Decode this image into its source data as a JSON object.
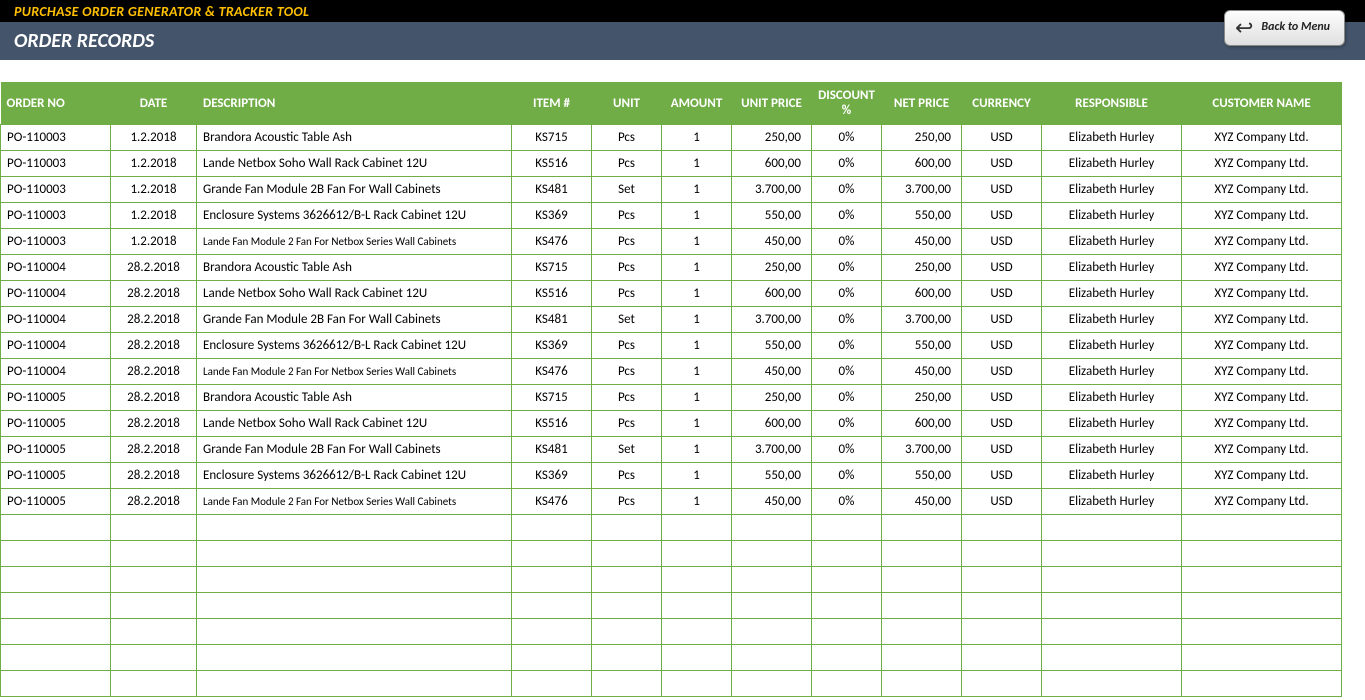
{
  "header": {
    "app_title": "PURCHASE ORDER GENERATOR & TRACKER TOOL",
    "page_title": "ORDER RECORDS",
    "back_button": "Back to Menu"
  },
  "columns": {
    "order_no": "ORDER NO",
    "date": "DATE",
    "description": "DESCRIPTION",
    "item": "ITEM #",
    "unit": "UNIT",
    "amount": "AMOUNT",
    "unit_price": "UNIT PRICE",
    "discount": "DISCOUNT %",
    "net_price": "NET PRICE",
    "currency": "CURRENCY",
    "responsible": "RESPONSIBLE",
    "customer": "CUSTOMER NAME"
  },
  "rows": [
    {
      "order_no": "PO-110003",
      "date": "1.2.2018",
      "description": "Brandora Acoustic Table Ash",
      "item": "KS715",
      "unit": "Pcs",
      "amount": "1",
      "unit_price": "250,00",
      "discount": "0%",
      "net_price": "250,00",
      "currency": "USD",
      "responsible": "Elizabeth Hurley",
      "customer": "XYZ Company Ltd.",
      "small": false
    },
    {
      "order_no": "PO-110003",
      "date": "1.2.2018",
      "description": "Lande Netbox Soho Wall Rack Cabinet 12U",
      "item": "KS516",
      "unit": "Pcs",
      "amount": "1",
      "unit_price": "600,00",
      "discount": "0%",
      "net_price": "600,00",
      "currency": "USD",
      "responsible": "Elizabeth Hurley",
      "customer": "XYZ Company Ltd.",
      "small": false
    },
    {
      "order_no": "PO-110003",
      "date": "1.2.2018",
      "description": "Grande Fan Module 2B Fan For Wall Cabinets",
      "item": "KS481",
      "unit": "Set",
      "amount": "1",
      "unit_price": "3.700,00",
      "discount": "0%",
      "net_price": "3.700,00",
      "currency": "USD",
      "responsible": "Elizabeth Hurley",
      "customer": "XYZ Company Ltd.",
      "small": false
    },
    {
      "order_no": "PO-110003",
      "date": "1.2.2018",
      "description": "Enclosure Systems 3626612/B-L Rack Cabinet 12U",
      "item": "KS369",
      "unit": "Pcs",
      "amount": "1",
      "unit_price": "550,00",
      "discount": "0%",
      "net_price": "550,00",
      "currency": "USD",
      "responsible": "Elizabeth Hurley",
      "customer": "XYZ Company Ltd.",
      "small": false
    },
    {
      "order_no": "PO-110003",
      "date": "1.2.2018",
      "description": "Lande Fan Module 2 Fan For Netbox Series Wall Cabinets",
      "item": "KS476",
      "unit": "Pcs",
      "amount": "1",
      "unit_price": "450,00",
      "discount": "0%",
      "net_price": "450,00",
      "currency": "USD",
      "responsible": "Elizabeth Hurley",
      "customer": "XYZ Company Ltd.",
      "small": true
    },
    {
      "order_no": "PO-110004",
      "date": "28.2.2018",
      "description": "Brandora Acoustic Table Ash",
      "item": "KS715",
      "unit": "Pcs",
      "amount": "1",
      "unit_price": "250,00",
      "discount": "0%",
      "net_price": "250,00",
      "currency": "USD",
      "responsible": "Elizabeth Hurley",
      "customer": "XYZ Company Ltd.",
      "small": false
    },
    {
      "order_no": "PO-110004",
      "date": "28.2.2018",
      "description": "Lande Netbox Soho Wall Rack Cabinet 12U",
      "item": "KS516",
      "unit": "Pcs",
      "amount": "1",
      "unit_price": "600,00",
      "discount": "0%",
      "net_price": "600,00",
      "currency": "USD",
      "responsible": "Elizabeth Hurley",
      "customer": "XYZ Company Ltd.",
      "small": false
    },
    {
      "order_no": "PO-110004",
      "date": "28.2.2018",
      "description": "Grande Fan Module 2B Fan For Wall Cabinets",
      "item": "KS481",
      "unit": "Set",
      "amount": "1",
      "unit_price": "3.700,00",
      "discount": "0%",
      "net_price": "3.700,00",
      "currency": "USD",
      "responsible": "Elizabeth Hurley",
      "customer": "XYZ Company Ltd.",
      "small": false
    },
    {
      "order_no": "PO-110004",
      "date": "28.2.2018",
      "description": "Enclosure Systems 3626612/B-L Rack Cabinet 12U",
      "item": "KS369",
      "unit": "Pcs",
      "amount": "1",
      "unit_price": "550,00",
      "discount": "0%",
      "net_price": "550,00",
      "currency": "USD",
      "responsible": "Elizabeth Hurley",
      "customer": "XYZ Company Ltd.",
      "small": false
    },
    {
      "order_no": "PO-110004",
      "date": "28.2.2018",
      "description": "Lande Fan Module 2 Fan For Netbox Series Wall Cabinets",
      "item": "KS476",
      "unit": "Pcs",
      "amount": "1",
      "unit_price": "450,00",
      "discount": "0%",
      "net_price": "450,00",
      "currency": "USD",
      "responsible": "Elizabeth Hurley",
      "customer": "XYZ Company Ltd.",
      "small": true
    },
    {
      "order_no": "PO-110005",
      "date": "28.2.2018",
      "description": "Brandora Acoustic Table Ash",
      "item": "KS715",
      "unit": "Pcs",
      "amount": "1",
      "unit_price": "250,00",
      "discount": "0%",
      "net_price": "250,00",
      "currency": "USD",
      "responsible": "Elizabeth Hurley",
      "customer": "XYZ Company Ltd.",
      "small": false
    },
    {
      "order_no": "PO-110005",
      "date": "28.2.2018",
      "description": "Lande Netbox Soho Wall Rack Cabinet 12U",
      "item": "KS516",
      "unit": "Pcs",
      "amount": "1",
      "unit_price": "600,00",
      "discount": "0%",
      "net_price": "600,00",
      "currency": "USD",
      "responsible": "Elizabeth Hurley",
      "customer": "XYZ Company Ltd.",
      "small": false
    },
    {
      "order_no": "PO-110005",
      "date": "28.2.2018",
      "description": "Grande Fan Module 2B Fan For Wall Cabinets",
      "item": "KS481",
      "unit": "Set",
      "amount": "1",
      "unit_price": "3.700,00",
      "discount": "0%",
      "net_price": "3.700,00",
      "currency": "USD",
      "responsible": "Elizabeth Hurley",
      "customer": "XYZ Company Ltd.",
      "small": false
    },
    {
      "order_no": "PO-110005",
      "date": "28.2.2018",
      "description": "Enclosure Systems 3626612/B-L Rack Cabinet 12U",
      "item": "KS369",
      "unit": "Pcs",
      "amount": "1",
      "unit_price": "550,00",
      "discount": "0%",
      "net_price": "550,00",
      "currency": "USD",
      "responsible": "Elizabeth Hurley",
      "customer": "XYZ Company Ltd.",
      "small": false
    },
    {
      "order_no": "PO-110005",
      "date": "28.2.2018",
      "description": "Lande Fan Module 2 Fan For Netbox Series Wall Cabinets",
      "item": "KS476",
      "unit": "Pcs",
      "amount": "1",
      "unit_price": "450,00",
      "discount": "0%",
      "net_price": "450,00",
      "currency": "USD",
      "responsible": "Elizabeth Hurley",
      "customer": "XYZ Company Ltd.",
      "small": true
    }
  ],
  "empty_rows": 7
}
